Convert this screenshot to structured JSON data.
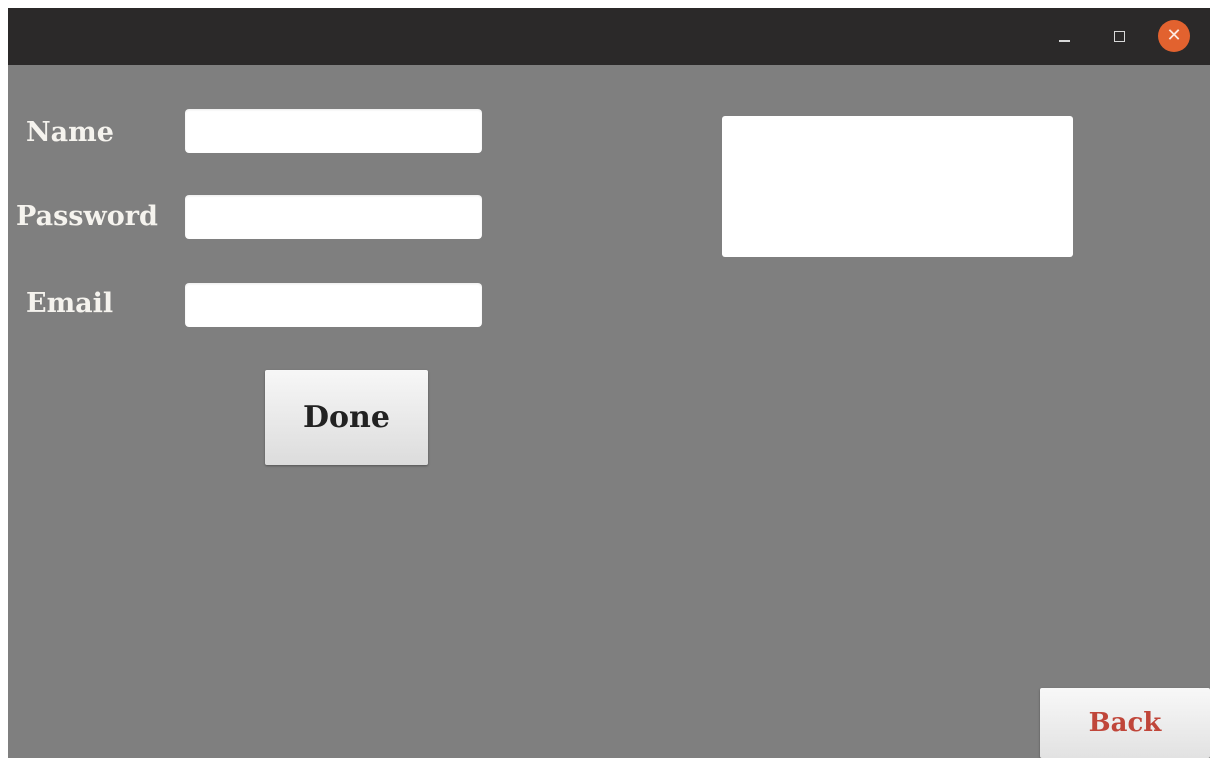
{
  "window": {
    "controls": {
      "minimize_icon": "minimize-icon",
      "maximize_icon": "maximize-icon",
      "close_icon": "close-icon",
      "close_glyph": "✕",
      "close_color": "#e2622f"
    }
  },
  "form": {
    "name_label": "Name",
    "name_value": "",
    "password_label": "Password",
    "password_value": "",
    "email_label": "Email",
    "email_value": "",
    "done_label": "Done"
  },
  "output": {
    "text": ""
  },
  "footer": {
    "back_label": "Back",
    "back_color": "#c0463a"
  },
  "colors": {
    "background": "#7f7f7f",
    "titlebar": "#2b2929",
    "label_text": "#f5f3ee"
  }
}
